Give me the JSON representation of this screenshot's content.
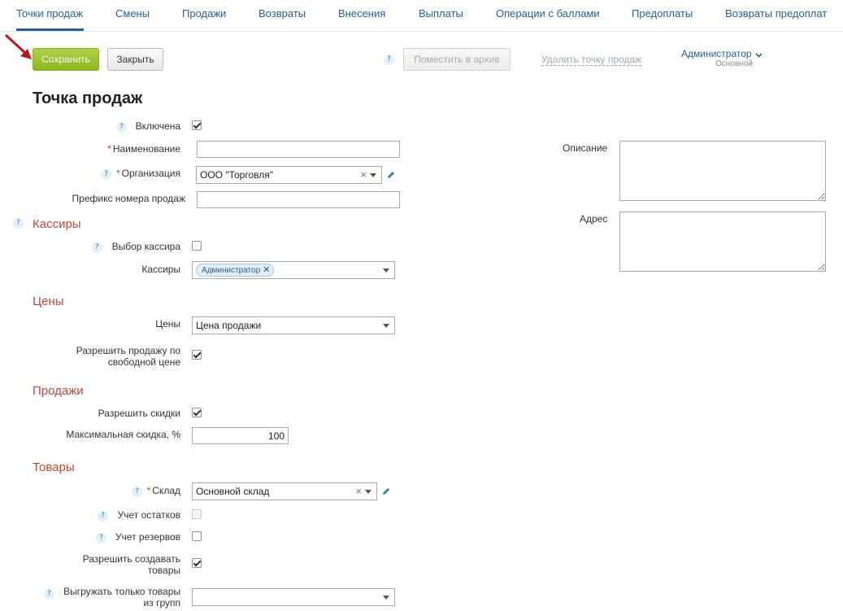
{
  "tabs": [
    {
      "label": "Точки продаж"
    },
    {
      "label": "Смены"
    },
    {
      "label": "Продажи"
    },
    {
      "label": "Возвраты"
    },
    {
      "label": "Внесения"
    },
    {
      "label": "Выплаты"
    },
    {
      "label": "Операции с баллами"
    },
    {
      "label": "Предоплаты"
    },
    {
      "label": "Возвраты предоплат"
    }
  ],
  "toolbar": {
    "save_label": "Сохранить",
    "close_label": "Закрыть",
    "help": "?",
    "archive_label": "Поместить в архив",
    "delete_label": "Удалить точку продаж",
    "user_name": "Администратор",
    "user_role": "Основной"
  },
  "page_title": "Точка продаж",
  "form": {
    "help": "?",
    "required_mark": "*",
    "enabled_label": "Включена",
    "name_label": "Наименование",
    "name_value": "",
    "org_label": "Организация",
    "org_value": "ООО \"Торговля\"",
    "prefix_label": "Префикс номера продаж",
    "prefix_value": "",
    "description_label": "Описание",
    "address_label": "Адрес"
  },
  "cashiers": {
    "section": "Кассиры",
    "choose_label": "Выбор кассира",
    "cashiers_label": "Кассиры",
    "tag": "Администратор"
  },
  "prices": {
    "section": "Цены",
    "prices_label": "Цены",
    "prices_value": "Цена продажи",
    "free_price_label_1": "Разрешить продажу по",
    "free_price_label_2": "свободной цене"
  },
  "sales": {
    "section": "Продажи",
    "discounts_label": "Разрешить скидки",
    "max_discount_label": "Максимальная скидка, %",
    "max_discount_value": "100"
  },
  "goods": {
    "section": "Товары",
    "warehouse_label": "Склад",
    "warehouse_value": "Основной склад",
    "stock_label": "Учет остатков",
    "reserve_label": "Учет резервов",
    "create_label_1": "Разрешить создавать",
    "create_label_2": "товары",
    "export_label_1": "Выгружать только товары",
    "export_label_2": "из групп"
  },
  "colors": {
    "accent": "#2a5f8f",
    "save_button": "#9bc331",
    "section_title": "#c0483a",
    "required": "#d23c2a"
  }
}
